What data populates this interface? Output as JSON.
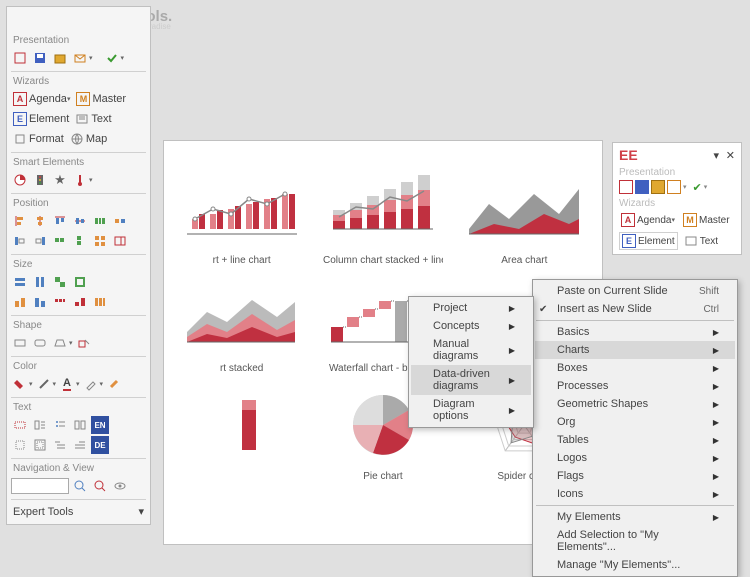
{
  "watermark": "DownloadDevTools.",
  "watermark2": "Developer's Paradise",
  "left": {
    "presentation": "Presentation",
    "wizards": "Wizards",
    "agenda": "Agenda",
    "master": "Master",
    "element": "Element",
    "text": "Text",
    "format": "Format",
    "map": "Map",
    "smart": "Smart Elements",
    "position": "Position",
    "size": "Size",
    "shape": "Shape",
    "color": "Color",
    "textsec": "Text",
    "nav": "Navigation & View",
    "expert": "Expert Tools"
  },
  "gallery": [
    "rt + line chart",
    "Column chart stacked + line...",
    "Area chart",
    "rt stacked",
    "Waterfall chart - build up",
    "",
    "",
    "Pie chart",
    "Spider chart"
  ],
  "right": {
    "logo": "EE",
    "presentation": "Presentation",
    "wizards": "Wizards",
    "agenda": "Agenda",
    "master": "Master",
    "element": "Element",
    "text": "Text"
  },
  "menu1": {
    "paste": "Paste on Current Slide",
    "paste_sc": "Shift",
    "insert": "Insert as New Slide",
    "insert_sc": "Ctrl",
    "basics": "Basics",
    "charts": "Charts",
    "boxes": "Boxes",
    "processes": "Processes",
    "geom": "Geometric Shapes",
    "org": "Org",
    "tables": "Tables",
    "logos": "Logos",
    "flags": "Flags",
    "icons": "Icons",
    "myel": "My Elements",
    "addsel": "Add Selection to \"My Elements\"...",
    "manage": "Manage \"My Elements\"..."
  },
  "menu2": {
    "project": "Project",
    "concepts": "Concepts",
    "manual": "Manual diagrams",
    "data": "Data-driven diagrams",
    "opts": "Diagram options"
  }
}
